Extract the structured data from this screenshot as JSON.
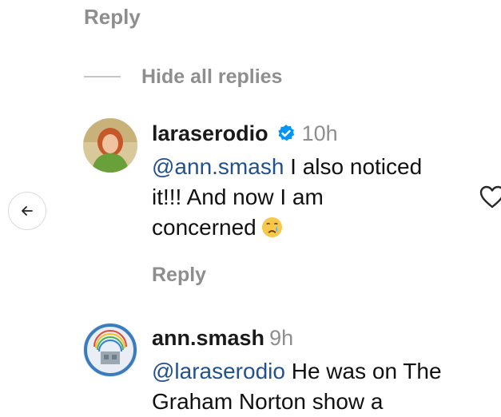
{
  "top": {
    "reply_label": "Reply"
  },
  "thread": {
    "hide_replies_label": "Hide all replies"
  },
  "comments": [
    {
      "username": "laraserodio",
      "verified": true,
      "time": "10h",
      "mention": "@ann.smash",
      "text_line1": " I also noticed",
      "text_line2": "it!!! And now I am",
      "text_line3": "concerned",
      "emoji": "crying-face",
      "reply_label": "Reply"
    },
    {
      "username": "ann.smash",
      "verified": false,
      "time": "9h",
      "mention": "@laraserodio",
      "text_line1": " He was on The",
      "text_line2": "Graham Norton show a"
    }
  ],
  "icons": {
    "back": "arrow-left-icon",
    "like": "heart-outline-icon",
    "verified": "verified-badge-icon"
  },
  "colors": {
    "mention": "#22518f",
    "secondary_text": "#8e8e8e",
    "verified_blue": "#0095f6"
  }
}
